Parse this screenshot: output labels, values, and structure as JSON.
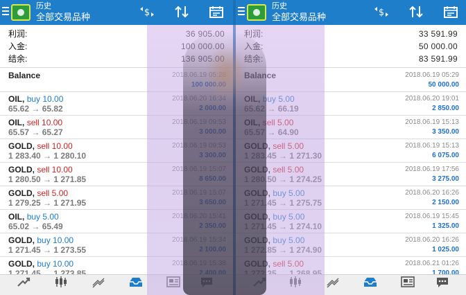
{
  "left": {
    "header": {
      "title": "历史",
      "subtitle": "全部交易品种"
    },
    "summary": [
      {
        "label": "利润:",
        "value": "36 905.00"
      },
      {
        "label": "入金:",
        "value": "100 000.00"
      },
      {
        "label": "结余:",
        "value": "136 905.00"
      }
    ],
    "deals": [
      {
        "symbol": "Balance",
        "side": "",
        "side_type": "",
        "price": "",
        "time": "2018.06.19 05:28",
        "profit": "100 000.00"
      },
      {
        "symbol": "OIL,",
        "side": "buy 10.00",
        "side_type": "buy",
        "price": "65.62 → 65.82",
        "time": "2018.06.20 16:34",
        "profit": "2 000.00"
      },
      {
        "symbol": "OIL,",
        "side": "sell 10.00",
        "side_type": "sell",
        "price": "65.57 → 65.27",
        "time": "2018.06.19 09:53",
        "profit": "3 000.00"
      },
      {
        "symbol": "GOLD,",
        "side": "sell 10.00",
        "side_type": "sell",
        "price": "1 283.40 → 1 280.10",
        "time": "2018.06.19 09:53",
        "profit": "3 300.00"
      },
      {
        "symbol": "GOLD,",
        "side": "sell 10.00",
        "side_type": "sell",
        "price": "1 280.50 → 1 271.85",
        "time": "2018.06.19 15:07",
        "profit": "8 650.00"
      },
      {
        "symbol": "GOLD,",
        "side": "sell 5.00",
        "side_type": "sell",
        "price": "1 279.25 → 1 271.95",
        "time": "2018.06.19 15:07",
        "profit": "3 650.00"
      },
      {
        "symbol": "OIL,",
        "side": "buy 5.00",
        "side_type": "buy",
        "price": "65.02 → 65.49",
        "time": "2018.06.20 15:41",
        "profit": "2 350.00"
      },
      {
        "symbol": "GOLD,",
        "side": "buy 10.00",
        "side_type": "buy",
        "price": "1 271.45 → 1 273.55",
        "time": "2018.06.19 15:34",
        "profit": "2 100.00"
      },
      {
        "symbol": "GOLD,",
        "side": "buy 10.00",
        "side_type": "buy",
        "price": "1 271.45 → 1 273.85",
        "time": "2018.06.19 15:38",
        "profit": "2 400.00"
      }
    ]
  },
  "right": {
    "header": {
      "title": "历史",
      "subtitle": "全部交易品种"
    },
    "summary": [
      {
        "label": "利润:",
        "value": "33 591.99"
      },
      {
        "label": "入金:",
        "value": "50 000.00"
      },
      {
        "label": "结余:",
        "value": "83 591.99"
      }
    ],
    "deals": [
      {
        "symbol": "Balance",
        "side": "",
        "side_type": "",
        "price": "",
        "time": "2018.06.19 05:29",
        "profit": "50 000.00"
      },
      {
        "symbol": "OIL,",
        "side": "buy 5.00",
        "side_type": "buy",
        "price": "65.62 → 66.19",
        "time": "2018.06.20 19:01",
        "profit": "2 850.00"
      },
      {
        "symbol": "OIL,",
        "side": "sell 5.00",
        "side_type": "sell",
        "price": "65.57 → 64.90",
        "time": "2018.06.19 15:13",
        "profit": "3 350.00"
      },
      {
        "symbol": "GOLD,",
        "side": "sell 5.00",
        "side_type": "sell",
        "price": "1 283.45 → 1 271.30",
        "time": "2018.06.19 15:13",
        "profit": "6 075.00"
      },
      {
        "symbol": "GOLD,",
        "side": "sell 5.00",
        "side_type": "sell",
        "price": "1 280.50 → 1 274.25",
        "time": "2018.06.19 17:56",
        "profit": "3 275.00"
      },
      {
        "symbol": "GOLD,",
        "side": "buy 5.00",
        "side_type": "buy",
        "price": "1 271.45 → 1 275.75",
        "time": "2018.06.20 16:26",
        "profit": "2 150.00"
      },
      {
        "symbol": "GOLD,",
        "side": "buy 5.00",
        "side_type": "buy",
        "price": "1 271.45 → 1 274.10",
        "time": "2018.06.19 15:45",
        "profit": "1 325.00"
      },
      {
        "symbol": "GOLD,",
        "side": "buy 5.00",
        "side_type": "buy",
        "price": "1 272.85 → 1 274.90",
        "time": "2018.06.20 16:26",
        "profit": "1 025.00"
      },
      {
        "symbol": "GOLD,",
        "side": "sell 5.00",
        "side_type": "sell",
        "price": "1 272.35 → 1 268.95",
        "time": "2018.06.21 01:26",
        "profit": "1 700.00"
      }
    ]
  },
  "icons": {
    "menu": "menu-icon",
    "logo": "app-logo",
    "currency": "currency-exchange-icon",
    "sort": "sort-icon",
    "calendar": "calendar-icon",
    "quotes": "quotes-icon",
    "chart": "chart-icon",
    "trade": "trade-icon",
    "history": "history-icon",
    "news": "news-icon",
    "chat": "chat-icon"
  },
  "colors": {
    "header": "#1f7ec9",
    "buy": "#1c7bd1",
    "sell": "#d41f1f",
    "profit": "#1c6fd0"
  }
}
